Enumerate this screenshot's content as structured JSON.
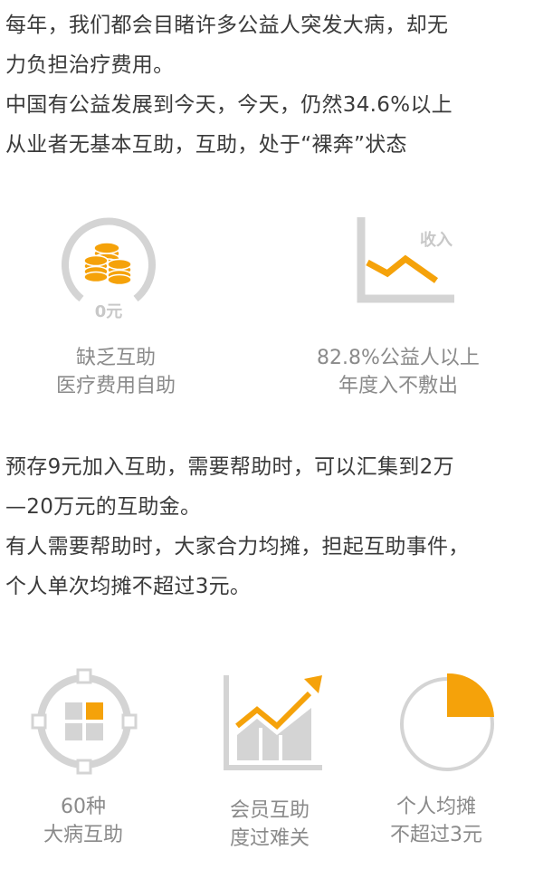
{
  "intro": {
    "lines": [
      "每年，我们都会目睹许多公益人突发大病，却无",
      "力负担治疗费用。",
      "中国有公益发展到今天，今天，仍然34.6%以上",
      "从业者无基本互助，互助，处于“裸奔”状态"
    ]
  },
  "stats": [
    {
      "icon": "coin-stack-icon",
      "icon_label": "0元",
      "caption": [
        "缺乏互助",
        "医疗费用自助"
      ]
    },
    {
      "icon": "declining-line-chart-icon",
      "icon_label": "收入",
      "caption": [
        "82.8%公益人以上",
        "年度入不敷出"
      ]
    }
  ],
  "plan": {
    "lines": [
      "预存9元加入互助，需要帮助时，可以汇集到2万",
      "—20万元的互助金。",
      "有人需要帮助时，大家合力均摊，担起互助事件，",
      "个人单次均摊不超过3元。"
    ]
  },
  "features": [
    {
      "icon": "grid-target-icon",
      "caption": [
        "60种",
        "大病互助"
      ]
    },
    {
      "icon": "rising-bar-chart-icon",
      "caption": [
        "会员互助",
        "度过难关"
      ]
    },
    {
      "icon": "pie-chart-icon",
      "caption": [
        "个人均摊",
        "不超过3元"
      ]
    }
  ],
  "colors": {
    "accent": "#f5a20a",
    "icon_gray": "#d4d4d4",
    "text": "#3a3a3a",
    "caption": "#8a8a8a"
  }
}
